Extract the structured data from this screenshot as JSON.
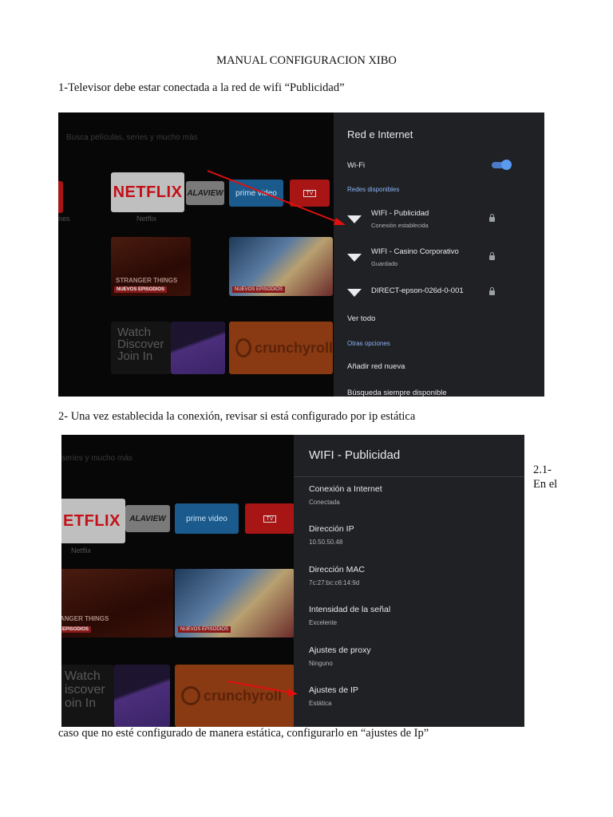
{
  "document": {
    "title": "MANUAL CONFIGURACION XIBO",
    "step1": "1-Televisor debe estar conectada a la red de wifi “Publicidad”",
    "step2": "2- Una vez establecida la conexión, revisar si está configurado por ip estática",
    "step21_start": "2.1- En el",
    "step21_end": "caso que no esté configurado de manera estática, configurarlo en “ajustes de Ip”"
  },
  "screenshot1": {
    "search_placeholder": "Busca películas, series y mucho más",
    "left_cut_label": "nes",
    "netflix_logo": "NETFLIX",
    "netflix_label": "Netflix",
    "alaview": "ALAVIEW",
    "prime": "prime video",
    "tv": "TV",
    "stranger_things": "STRANGER THINGS",
    "nuevos_episodios": "NUEVOS EPISODIOS",
    "watch_tile": [
      "Watch",
      "Discover",
      "Join In"
    ],
    "crunchyroll": "crunchyroll",
    "panel": {
      "title": "Red e Internet",
      "wifi_label": "Wi-Fi",
      "wifi_on": true,
      "available_header": "Redes disponibles",
      "networks": [
        {
          "name": "WIFI - Publicidad",
          "status": "Conexión establecida"
        },
        {
          "name": "WIFI - Casino Corporativo",
          "status": "Guardado"
        },
        {
          "name": "DIRECT-epson-026d-0-001",
          "status": ""
        }
      ],
      "see_all": "Ver todo",
      "other_header": "Otras opciones",
      "add_network": "Añadir red nueva",
      "always_scan": "Búsqueda siempre disponible"
    },
    "arrow_color": "#e01010"
  },
  "screenshot2": {
    "search_placeholder": "series y mucho más",
    "netflix_logo": "ETFLIX",
    "netflix_label": "Netflix",
    "alaview": "ALAVIEW",
    "prime": "prime video",
    "tv": "TV",
    "stranger_things": "ANGER THINGS",
    "nuevos_episodios": "EPISODIOS",
    "nuevos_episodios_2": "NUEVOS EPISODIOS",
    "watch_tile": [
      "Watch",
      "iscover",
      "oin In"
    ],
    "crunchyroll": "crunchyroll",
    "panel": {
      "title": "WIFI - Publicidad",
      "items": [
        {
          "label": "Conexión a Internet",
          "value": "Conectada"
        },
        {
          "label": "Dirección IP",
          "value": "10.50.50.48"
        },
        {
          "label": "Dirección MAC",
          "value": "7c:27:bc:c6:14:9d"
        },
        {
          "label": "Intensidad de la señal",
          "value": "Excelente"
        },
        {
          "label": "Ajustes de proxy",
          "value": "Ninguno"
        },
        {
          "label": "Ajustes de IP",
          "value": "Estática"
        }
      ]
    },
    "arrow_color": "#e01010"
  }
}
